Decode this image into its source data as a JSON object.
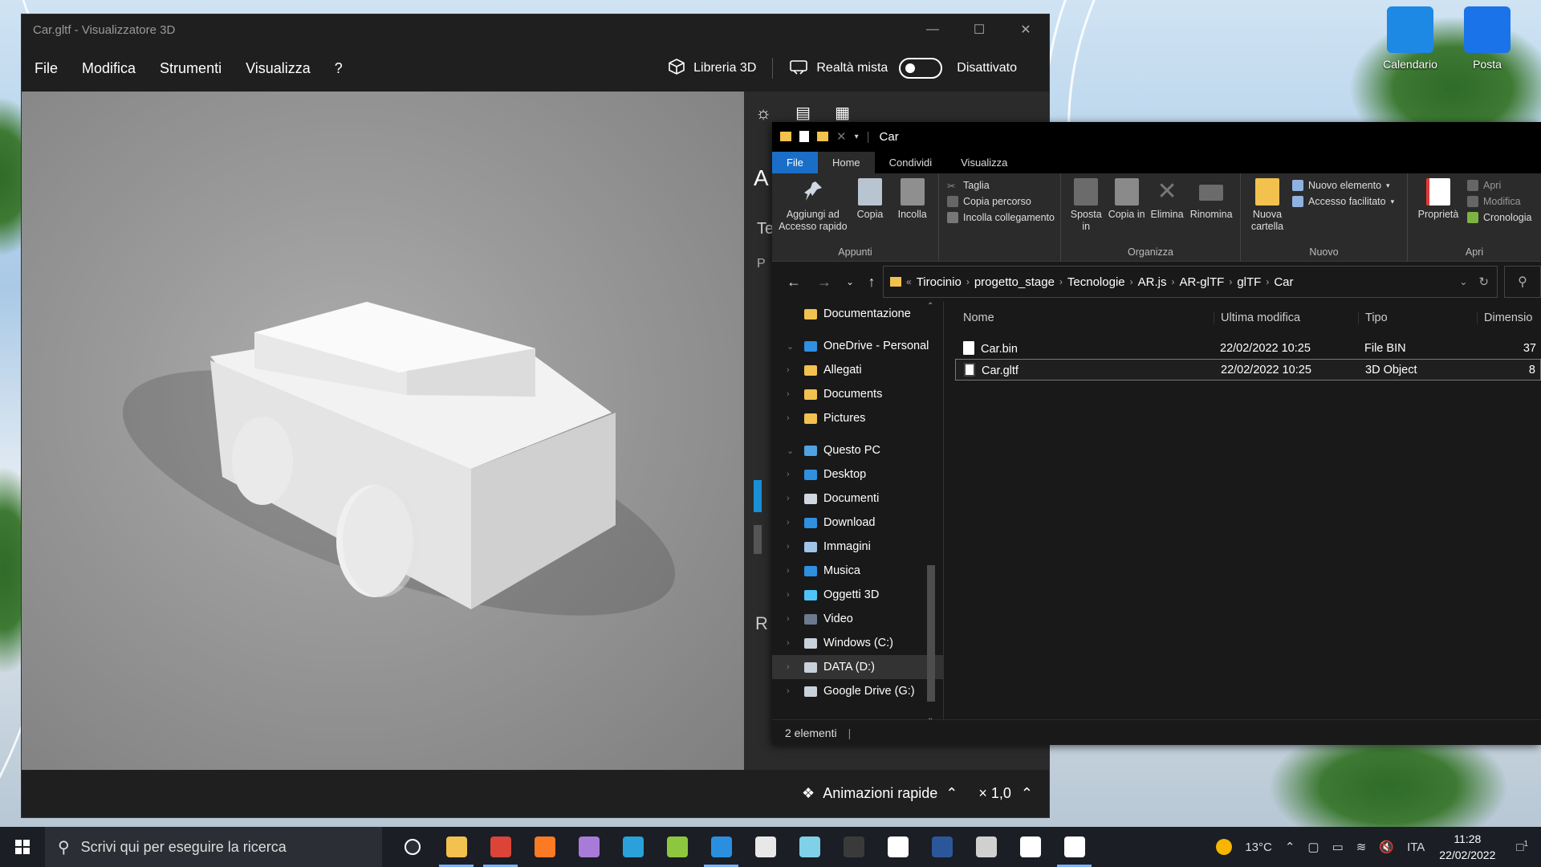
{
  "desktop": {
    "icons": [
      {
        "label": "Calendario",
        "color": "#1e88e5"
      },
      {
        "label": "Posta",
        "color": "#1a73e8"
      }
    ]
  },
  "viewer": {
    "title": "Car.gltf - Visualizzatore 3D",
    "menu": [
      "File",
      "Modifica",
      "Strumenti",
      "Visualizza",
      "?"
    ],
    "library_label": "Libreria 3D",
    "mixed_reality_label": "Realtà mista",
    "toggle_state": "Disattivato",
    "side_letters": [
      "A",
      "Te",
      "P",
      "R"
    ],
    "animations_label": "Animazioni rapide",
    "speed_label": "× 1,0"
  },
  "explorer": {
    "title": "Car",
    "tabs": [
      "File",
      "Home",
      "Condividi",
      "Visualizza"
    ],
    "ribbon": {
      "appunti": {
        "label": "Appunti",
        "pin": "Aggiungi ad Accesso rapido",
        "copy": "Copia",
        "paste": "Incolla",
        "cut": "Taglia",
        "copy_path": "Copia percorso",
        "paste_link": "Incolla collegamento"
      },
      "organizza": {
        "label": "Organizza",
        "move": "Sposta in",
        "copy_to": "Copia in",
        "delete": "Elimina",
        "rename": "Rinomina"
      },
      "nuovo": {
        "label": "Nuovo",
        "new_folder": "Nuova cartella",
        "new_item": "Nuovo elemento",
        "easy_access": "Accesso facilitato"
      },
      "apri": {
        "label": "Apri",
        "properties": "Proprietà",
        "open": "Apri",
        "edit": "Modifica",
        "history": "Cronologia"
      }
    },
    "breadcrumb": [
      "Tirocinio",
      "progetto_stage",
      "Tecnologie",
      "AR.js",
      "AR-glTF",
      "glTF",
      "Car"
    ],
    "nav": [
      {
        "label": "Documentazione",
        "kind": "folder",
        "level": 1
      },
      {
        "label": "OneDrive - Personal",
        "kind": "cloud",
        "level": 0
      },
      {
        "label": "Allegati",
        "kind": "folder",
        "level": 1
      },
      {
        "label": "Documents",
        "kind": "folder",
        "level": 1
      },
      {
        "label": "Pictures",
        "kind": "folder",
        "level": 1
      },
      {
        "label": "Questo PC",
        "kind": "pc",
        "level": 0
      },
      {
        "label": "Desktop",
        "kind": "desktop",
        "level": 1
      },
      {
        "label": "Documenti",
        "kind": "doc",
        "level": 1
      },
      {
        "label": "Download",
        "kind": "download",
        "level": 1
      },
      {
        "label": "Immagini",
        "kind": "image",
        "level": 1
      },
      {
        "label": "Musica",
        "kind": "music",
        "level": 1
      },
      {
        "label": "Oggetti 3D",
        "kind": "cube",
        "level": 1
      },
      {
        "label": "Video",
        "kind": "video",
        "level": 1
      },
      {
        "label": "Windows (C:)",
        "kind": "drive",
        "level": 1
      },
      {
        "label": "DATA (D:)",
        "kind": "drive",
        "level": 1
      },
      {
        "label": "Google Drive (G:)",
        "kind": "drive",
        "level": 1
      }
    ],
    "columns": [
      "Nome",
      "Ultima modifica",
      "Tipo",
      "Dimensio"
    ],
    "files": [
      {
        "name": "Car.bin",
        "date": "22/02/2022 10:25",
        "type": "File BIN",
        "size": "37"
      },
      {
        "name": "Car.gltf",
        "date": "22/02/2022 10:25",
        "type": "3D Object",
        "size": "8"
      }
    ],
    "status": "2 elementi"
  },
  "taskbar": {
    "search_placeholder": "Scrivi qui per eseguire la ricerca",
    "weather": "13°C",
    "language": "ITA",
    "time": "11:28",
    "date": "22/02/2022",
    "notification_count": "1",
    "apps": [
      {
        "name": "task-view-icon",
        "color": "#2b2e34"
      },
      {
        "name": "file-explorer-icon",
        "color": "#f2c14e"
      },
      {
        "name": "chrome-icon",
        "color": "#db4437"
      },
      {
        "name": "xampp-icon",
        "color": "#fb7a24"
      },
      {
        "name": "paint3d-icon",
        "color": "#a97bd8"
      },
      {
        "name": "telegram-icon",
        "color": "#2aa1da"
      },
      {
        "name": "notepadpp-icon",
        "color": "#8dc63f"
      },
      {
        "name": "vscode-icon",
        "color": "#2b8fe0"
      },
      {
        "name": "jetbrains-icon",
        "color": "#e8e8e8"
      },
      {
        "name": "mixed-reality-icon",
        "color": "#7fd1e8"
      },
      {
        "name": "obs-icon",
        "color": "#3a3a3a"
      },
      {
        "name": "github-icon",
        "color": "#ffffff"
      },
      {
        "name": "word-icon",
        "color": "#2b579a"
      },
      {
        "name": "unity-icon",
        "color": "#d0d0d0"
      },
      {
        "name": "unity-hub-icon",
        "color": "#ffffff"
      },
      {
        "name": "3d-viewer-icon",
        "color": "#ffffff"
      }
    ]
  }
}
